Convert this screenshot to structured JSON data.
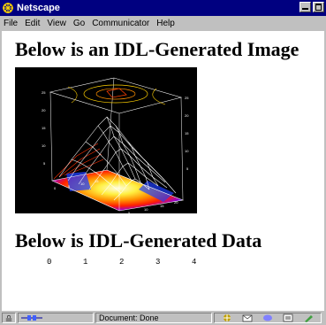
{
  "window": {
    "title": "Netscape"
  },
  "menu": [
    {
      "label": "File"
    },
    {
      "label": "Edit"
    },
    {
      "label": "View"
    },
    {
      "label": "Go"
    },
    {
      "label": "Communicator"
    },
    {
      "label": "Help"
    }
  ],
  "content": {
    "heading_image": "Below is an IDL-Generated Image",
    "heading_data": "Below is IDL-Generated Data",
    "data_values": [
      "0",
      "1",
      "2",
      "3",
      "4"
    ]
  },
  "status": {
    "text": "Document: Done"
  },
  "colors": {
    "titlebar": "#000080",
    "chrome": "#c0c0c0",
    "page": "#ffffff",
    "plot_background": "#000000",
    "mesh": "#ffffff",
    "surface_warm": "#ff3000",
    "surface_cool": "#2030ff"
  },
  "icons": [
    "netscape-app-icon",
    "minimize-icon",
    "maximize-icon",
    "lock-icon",
    "connection-icon",
    "component-icons"
  ]
}
